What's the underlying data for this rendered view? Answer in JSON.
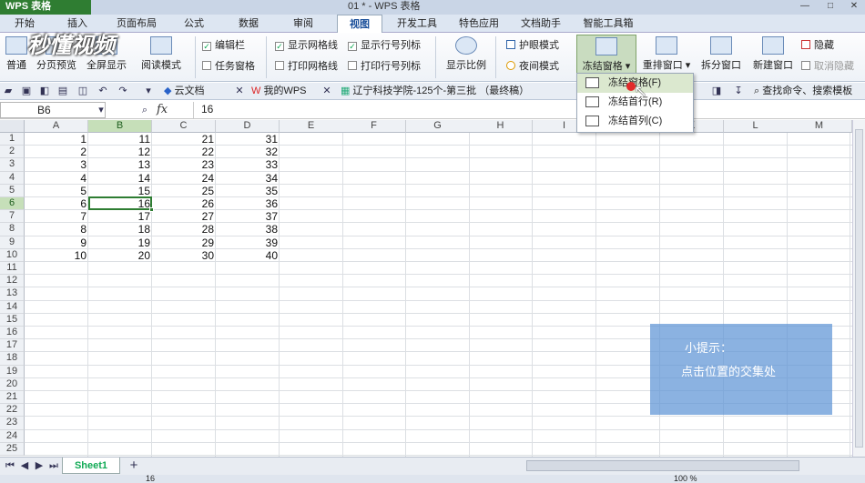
{
  "app": {
    "name": "WPS 表格",
    "title": "01 * - WPS 表格"
  },
  "menu": [
    "开始",
    "插入",
    "页面布局",
    "公式",
    "数据",
    "审阅",
    "视图",
    "开发工具",
    "特色应用",
    "文档助手",
    "智能工具箱"
  ],
  "ribbon": {
    "normal": "普通",
    "page_preview": "分页预览",
    "fullscreen": "全屏显示",
    "read_mode": "阅读模式",
    "edit_bar": "编辑栏",
    "task_pane": "任务窗格",
    "show_grid": "显示网格线",
    "print_grid": "打印网格线",
    "show_headers": "显示行号列标",
    "print_headers": "打印行号列标",
    "zoom": "显示比例",
    "eye_mode": "护眼模式",
    "night_mode": "夜间模式",
    "freeze": "冻结窗格",
    "rearrange": "重排窗口",
    "split": "拆分窗口",
    "new_window": "新建窗口",
    "hide": "隐藏",
    "unhide": "取消隐藏"
  },
  "doc_tabs": [
    "云文档",
    "我的WPS",
    "辽宁科技学院-125个-第三批 （最终稿）"
  ],
  "search_placeholder": "查找命令、搜索模板",
  "namebox": "B6",
  "fx": "fx",
  "formula": "16",
  "columns": [
    "A",
    "B",
    "C",
    "D",
    "E",
    "F",
    "G",
    "H",
    "I",
    "J",
    "K",
    "L",
    "M"
  ],
  "rows": [
    "1",
    "2",
    "3",
    "4",
    "5",
    "6",
    "7",
    "8",
    "9",
    "10",
    "11",
    "12",
    "13",
    "14",
    "15",
    "16",
    "17",
    "18",
    "19",
    "20",
    "21",
    "22",
    "23",
    "24",
    "25"
  ],
  "cells": [
    [
      "1",
      "11",
      "21",
      "31"
    ],
    [
      "2",
      "12",
      "22",
      "32"
    ],
    [
      "3",
      "13",
      "23",
      "33"
    ],
    [
      "4",
      "14",
      "24",
      "34"
    ],
    [
      "5",
      "15",
      "25",
      "35"
    ],
    [
      "6",
      "16",
      "26",
      "36"
    ],
    [
      "7",
      "17",
      "27",
      "37"
    ],
    [
      "8",
      "18",
      "28",
      "38"
    ],
    [
      "9",
      "19",
      "29",
      "39"
    ],
    [
      "10",
      "20",
      "30",
      "40"
    ]
  ],
  "dropdown": {
    "freeze_panes": "冻结窗格(F)",
    "freeze_top_row": "冻结首行(R)",
    "freeze_first_col": "冻结首列(C)"
  },
  "tip": {
    "title": "小提示：",
    "text": "点击位置的交集处"
  },
  "sheet": "Sheet1",
  "status": {
    "value": "16",
    "zoom": "100 %"
  },
  "watermark": "秒懂视频"
}
